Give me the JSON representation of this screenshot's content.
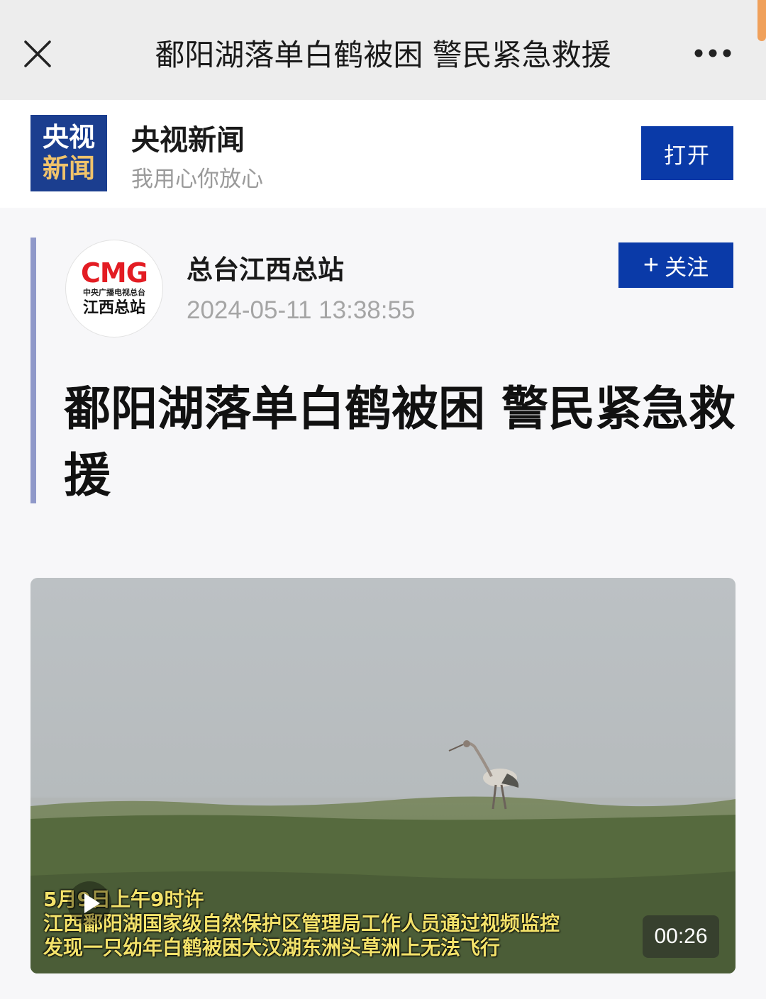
{
  "nav": {
    "title": "鄱阳湖落单白鹤被困 警民紧急救援",
    "close_icon": "close-icon",
    "more_icon": "more-dots-icon"
  },
  "app_banner": {
    "logo_line1": "央视",
    "logo_line2": "新闻",
    "name": "央视新闻",
    "slogan": "我用心你放心",
    "open_label": "打开"
  },
  "source": {
    "avatar_brand": "CMG",
    "avatar_sub": "中央广播电视总台",
    "avatar_station": "江西总站",
    "name": "总台江西总站",
    "time": "2024-05-11 13:38:55",
    "follow_label": "关注",
    "follow_icon": "plus-icon"
  },
  "article": {
    "title": "鄱阳湖落单白鹤被困 警民紧急救援"
  },
  "video": {
    "caption_line1": "5月9日上午9时许",
    "caption_line2": "江西鄱阳湖国家级自然保护区管理局工作人员通过视频监控",
    "caption_line3": "发现一只幼年白鹤被困大汉湖东洲头草洲上无法飞行",
    "duration": "00:26",
    "play_icon": "play-icon"
  },
  "colors": {
    "brand_blue": "#0a3aa8",
    "accent_line": "#8f98c9",
    "caption_yellow": "#f3e26a"
  }
}
